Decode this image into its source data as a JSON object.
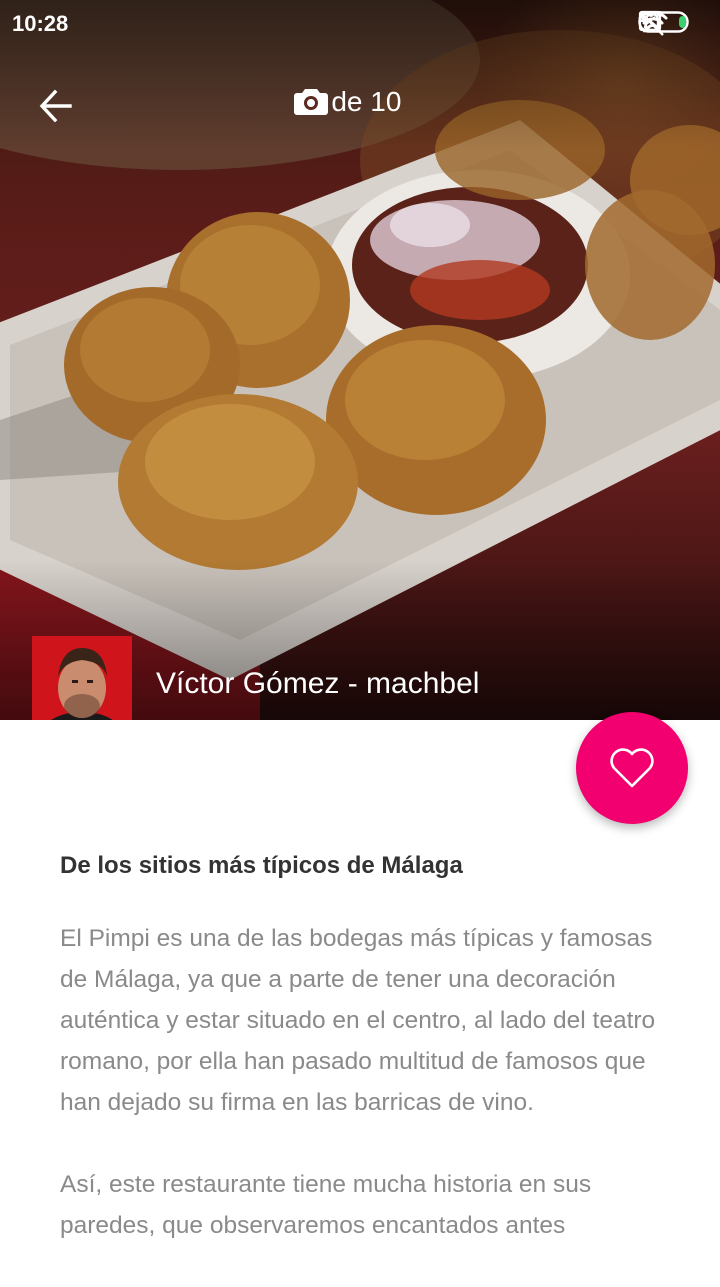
{
  "status_bar": {
    "time": "10:28",
    "icons": [
      "more-dots-icon",
      "vibrate-off-icon",
      "wifi-icon",
      "sim-icon",
      "charging-icon",
      "battery-icon"
    ]
  },
  "gallery": {
    "counter": "1 de 10",
    "back_icon": "arrow-back-icon",
    "camera_icon": "camera-icon"
  },
  "author": {
    "name": "Víctor Gómez - machbel"
  },
  "favorite": {
    "icon": "heart-outline-icon",
    "color": "#f2006f"
  },
  "article": {
    "title": "De los sitios más típicos de Málaga",
    "paragraphs": [
      "El Pimpi es una de las bodegas más típicas y famosas de Málaga, ya que a parte de tener una decoración auténtica y estar situado en el centro, al lado del teatro romano, por ella han pasado multitud de famosos que han dejado su firma en las barricas de vino.",
      "Así, este restaurante tiene mucha historia en sus paredes, que observaremos encantados antes"
    ]
  }
}
